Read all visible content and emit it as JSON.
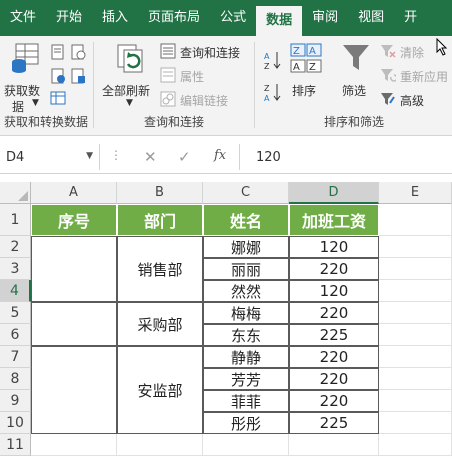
{
  "tabs": [
    "文件",
    "开始",
    "插入",
    "页面布局",
    "公式",
    "数据",
    "审阅",
    "视图",
    "开"
  ],
  "active_tab": "数据",
  "ribbon": {
    "get_data": {
      "line1": "获取数",
      "line2": "据"
    },
    "group1_label": "获取和转换数据",
    "refresh_all": "全部刷新",
    "queries_connections": "查询和连接",
    "properties": "属性",
    "edit_links": "编辑链接",
    "group2_label": "查询和连接",
    "sort": "排序",
    "filter": "筛选",
    "clear": "清除",
    "reapply": "重新应用",
    "advanced": "高级",
    "group3_label": "排序和筛选"
  },
  "formula_bar": {
    "name_box": "D4",
    "fx": "fx",
    "value": "120"
  },
  "columns": [
    "A",
    "B",
    "C",
    "D",
    "E"
  ],
  "selected_column": "D",
  "rows": [
    "1",
    "2",
    "3",
    "4",
    "5",
    "6",
    "7",
    "8",
    "9",
    "10",
    "11"
  ],
  "selected_row": "4",
  "table": {
    "headers": [
      "序号",
      "部门",
      "姓名",
      "加班工资"
    ],
    "departments": [
      "销售部",
      "采购部",
      "安监部"
    ],
    "names": [
      "娜娜",
      "丽丽",
      "然然",
      "梅梅",
      "东东",
      "静静",
      "芳芳",
      "菲菲",
      "彤彤"
    ],
    "wages": [
      "120",
      "220",
      "120",
      "220",
      "225",
      "220",
      "220",
      "220",
      "225"
    ]
  },
  "colors": {
    "excel_green": "#217346",
    "header_fill": "#70ad47"
  }
}
